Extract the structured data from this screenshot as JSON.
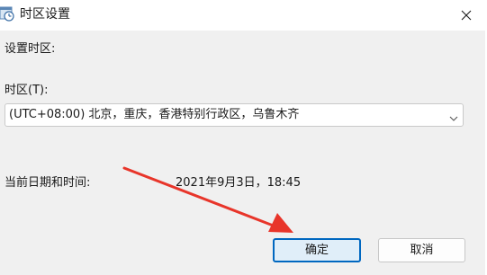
{
  "window": {
    "title": "时区设置",
    "icon": "clock-settings-icon",
    "close_icon": "close-icon"
  },
  "form": {
    "section_label": "设置时区:",
    "timezone_label": "时区(T):",
    "timezone_value": "(UTC+08:00) 北京，重庆，香港特别行政区，乌鲁木齐",
    "current_datetime_label": "当前日期和时间:",
    "current_datetime_value": "2021年9月3日，18:45"
  },
  "buttons": {
    "ok": "确定",
    "cancel": "取消"
  },
  "colors": {
    "accent": "#0067c0",
    "annotation_arrow": "#e8352a",
    "content_bg": "#f0f0f0"
  }
}
